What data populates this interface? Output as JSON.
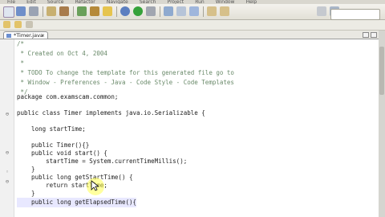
{
  "menu": [
    "File",
    "Edit",
    "Source",
    "Refactor",
    "Navigate",
    "Search",
    "Project",
    "Run",
    "Window",
    "Help"
  ],
  "editor": {
    "tab_label": "*Timer.java",
    "tab_close": "×",
    "lines": [
      "/*",
      " * Created on Oct 4, 2004",
      " *",
      " * TODO To change the template for this generated file go to",
      " * Window - Preferences - Java - Code Style - Code Templates",
      " */",
      "package com.examscam.common;",
      "",
      "public class Timer implements java.io.Serializable {",
      "",
      "    long startTime;",
      "",
      "    public Timer(){}",
      "    public void start() {",
      "        startTime = System.currentTimeMillis();",
      "    }",
      "    public long getStartTime() {",
      "        return startTime;",
      "    }",
      "    public long getElapsedTime(){"
    ]
  },
  "icons": {
    "fold_minus": "⊖",
    "fold_marker": "◦"
  },
  "colors": {
    "keyword": "#7f0055",
    "comment": "#6a8a6a",
    "highlight_spot": "#ffff50"
  }
}
